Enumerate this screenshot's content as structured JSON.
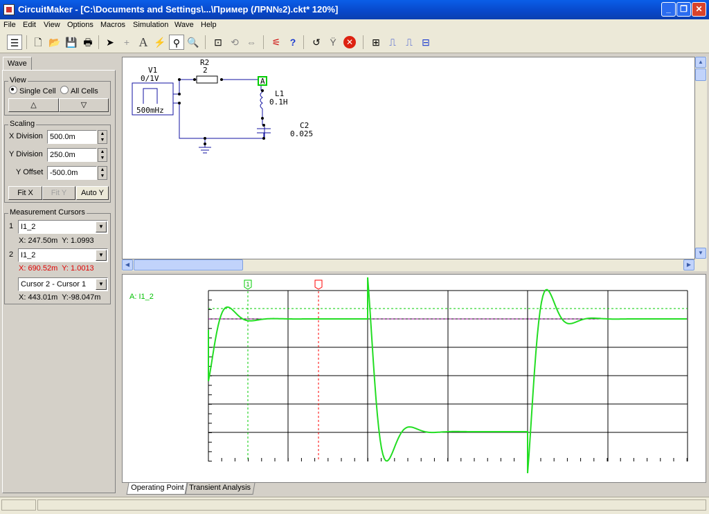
{
  "window": {
    "title": "CircuitMaker - [C:\\Documents and Settings\\...\\Пример (ЛРN№2).ckt* 120%]"
  },
  "menu": [
    "File",
    "Edit",
    "View",
    "Options",
    "Macros",
    "Simulation",
    "Wave",
    "Help"
  ],
  "left": {
    "tab": "Wave",
    "view": {
      "label": "View",
      "single": "Single Cell",
      "all": "All Cells"
    },
    "scaling": {
      "label": "Scaling",
      "xdiv_label": "X Division",
      "xdiv": "500.0m",
      "ydiv_label": "Y Division",
      "ydiv": "250.0m",
      "yoff_label": "Y Offset",
      "yoff": "-500.0m",
      "fitx": "Fit X",
      "fity": "Fit Y",
      "autoy": "Auto Y"
    },
    "cursors": {
      "label": "Measurement Cursors",
      "c1_num": "1",
      "c1_trace": "I1_2",
      "c1_x": "X: 247.50m",
      "c1_y": "Y: 1.0993",
      "c2_num": "2",
      "c2_trace": "I1_2",
      "c2_x": "X: 690.52m",
      "c2_y": "Y: 1.0013",
      "diff_select": "Cursor 2 - Cursor 1",
      "diff_x": "X: 443.01m",
      "diff_y": "Y:-98.047m"
    }
  },
  "schematic": {
    "v1": "V1",
    "v1_val": "0/1V",
    "v1_freq": "500mHz",
    "r2": "R2",
    "r2_val": "2",
    "l1": "L1",
    "l1_val": "0.1H",
    "c2": "C2",
    "c2_val": "0.025",
    "probe": "A"
  },
  "wave": {
    "trace_label": "A: I1_2",
    "cursor1": "1",
    "cursor_color": "#ff0000",
    "trace_color": "#00e000"
  },
  "bottom_tabs": [
    "Operating Point",
    "Transient Analysis"
  ]
}
